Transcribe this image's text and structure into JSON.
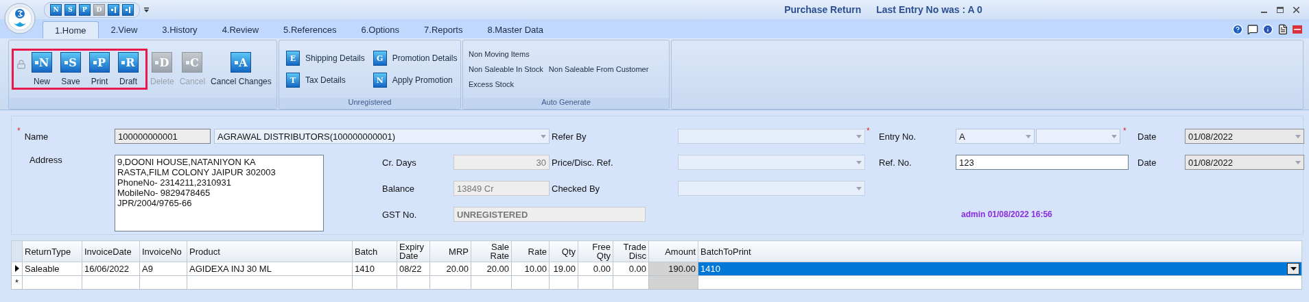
{
  "window": {
    "title": "Purchase Return",
    "subtitle": "Last Entry No was : A 0"
  },
  "quick_access": [
    {
      "glyph": "N",
      "disabled": false
    },
    {
      "glyph": "S",
      "disabled": false
    },
    {
      "glyph": "P",
      "disabled": false
    },
    {
      "glyph": "D",
      "disabled": true
    },
    {
      "disabled": false
    },
    {
      "disabled": false
    }
  ],
  "tabs": [
    {
      "label": "1.Home",
      "selected": true
    },
    {
      "label": "2.View",
      "selected": false
    },
    {
      "label": "3.History",
      "selected": false
    },
    {
      "label": "4.Review",
      "selected": false
    },
    {
      "label": "5.References",
      "selected": false
    },
    {
      "label": "6.Options",
      "selected": false
    },
    {
      "label": "7.Reports",
      "selected": false
    },
    {
      "label": "8.Master Data",
      "selected": false
    }
  ],
  "ribbon": {
    "highlighted_actions": [
      {
        "kind": "lock",
        "disabled": true
      },
      {
        "kind": "button",
        "label": "New",
        "glyph": "N",
        "disabled": false
      },
      {
        "kind": "button",
        "label": "Save",
        "glyph": "S",
        "disabled": false
      },
      {
        "kind": "button",
        "label": "Print",
        "glyph": "P",
        "disabled": false
      },
      {
        "kind": "button",
        "label": "Draft",
        "glyph": "R",
        "disabled": false
      }
    ],
    "actions": [
      {
        "kind": "button",
        "label": "Delete",
        "glyph": "D",
        "disabled": true
      },
      {
        "kind": "button",
        "label": "Cancel",
        "glyph": "C",
        "disabled": true
      },
      {
        "kind": "button",
        "label": "Cancel Changes",
        "glyph": "A",
        "disabled": false
      }
    ],
    "details": {
      "caption": "Unregistered",
      "buttons": [
        {
          "label": "Shipping Details",
          "glyph": "E"
        },
        {
          "label": "Promotion Details",
          "glyph": "G"
        },
        {
          "label": "Tax Details",
          "glyph": "T"
        },
        {
          "label": "Apply Promotion",
          "glyph": "N"
        }
      ]
    },
    "auto_generate": {
      "caption": "Auto Generate",
      "rows": [
        [
          "Non Moving Items"
        ],
        [
          "Non Saleable In Stock",
          "Non Saleable From Customer"
        ],
        [
          "Excess Stock"
        ]
      ]
    }
  },
  "party": {
    "name_label": "Name",
    "required_mark": "*",
    "code": "100000000001",
    "name": "AGRAWAL DISTRIBUTORS(100000000001)",
    "address_label": "Address",
    "address": [
      "9,DOONI HOUSE,NATANIYON KA",
      "RASTA,FILM COLONY JAIPUR 302003",
      "PhoneNo- 2314211,2310931",
      "MobileNo- 9829478465",
      "JPR/2004/9765-66"
    ]
  },
  "account": [
    {
      "label": "Cr. Days",
      "value": "30",
      "kind": "number"
    },
    {
      "label": "Balance",
      "value": "13849 Cr",
      "kind": "text"
    },
    {
      "label": "GST No.",
      "value": "UNREGISTERED",
      "kind": "status"
    }
  ],
  "references": [
    {
      "label": "Refer By",
      "required_mark": "*"
    },
    {
      "label": "Price/Disc. Ref."
    },
    {
      "label": "Checked By"
    }
  ],
  "entry": {
    "label": "Entry No.",
    "series": "A",
    "required_mark": "*",
    "ref_label": "Ref. No.",
    "ref_value": "123"
  },
  "dates": [
    {
      "label": "Date",
      "value": "01/08/2022"
    },
    {
      "label": "Date",
      "value": "01/08/2022"
    }
  ],
  "audit": "admin 01/08/2022 16:56",
  "grid": {
    "columns": [
      {
        "label": "ReturnType",
        "numeric": false
      },
      {
        "label": "InvoiceDate",
        "numeric": false
      },
      {
        "label": "InvoiceNo",
        "numeric": false
      },
      {
        "label": "Product",
        "numeric": false
      },
      {
        "label": "Batch",
        "numeric": false
      },
      {
        "label": "Expiry Date",
        "numeric": false
      },
      {
        "label": "MRP",
        "numeric": true
      },
      {
        "label": "Sale Rate",
        "numeric": true
      },
      {
        "label": "Rate",
        "numeric": true
      },
      {
        "label": "Qty",
        "numeric": true
      },
      {
        "label": "Free Qty",
        "numeric": true
      },
      {
        "label": "Trade Disc",
        "numeric": true
      },
      {
        "label": "Amount",
        "numeric": true,
        "readonly": true
      },
      {
        "label": "BatchToPrint",
        "numeric": false,
        "kind": "combo"
      }
    ],
    "rows": [
      {
        "current": true,
        "cells": [
          {
            "text": "Saleable",
            "selected": false
          },
          {
            "text": "16/06/2022",
            "selected": false
          },
          {
            "text": "A9",
            "selected": false
          },
          {
            "text": "AGIDEXA INJ 30 ML",
            "selected": false
          },
          {
            "text": "1410",
            "selected": false
          },
          {
            "text": "08/22",
            "selected": false
          },
          {
            "text": "20.00",
            "selected": false
          },
          {
            "text": "20.00",
            "selected": false
          },
          {
            "text": "10.00",
            "selected": false
          },
          {
            "text": "19.00",
            "selected": false
          },
          {
            "text": "0.00",
            "selected": false
          },
          {
            "text": "0.00",
            "selected": false
          },
          {
            "text": "190.00",
            "selected": false
          },
          {
            "text": "1410",
            "selected": true
          }
        ]
      }
    ],
    "new_row_marker": "*"
  }
}
